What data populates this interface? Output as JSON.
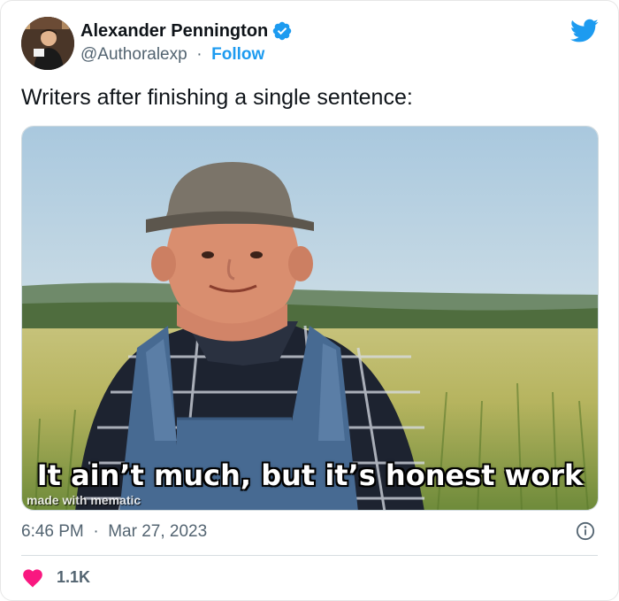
{
  "author": {
    "name": "Alexander Pennington",
    "handle": "@Authoralexp",
    "separator": "·",
    "follow_label": "Follow",
    "verified_icon": "verified-badge-icon"
  },
  "brand_icon": "twitter-bird-icon",
  "tweet": {
    "text": "Writers after finishing a single sentence:"
  },
  "media": {
    "caption": "It ain’t much, but it’s honest work",
    "watermark": "made with mematic"
  },
  "meta": {
    "time": "6:46 PM",
    "separator": "·",
    "date": "Mar 27, 2023",
    "info_icon": "info-icon"
  },
  "engagement": {
    "likes_icon": "heart-icon",
    "likes": "1.1K"
  },
  "colors": {
    "accent": "#1d9bf0",
    "text": "#0f1419",
    "secondary": "#536471",
    "heart": "#f91880"
  }
}
